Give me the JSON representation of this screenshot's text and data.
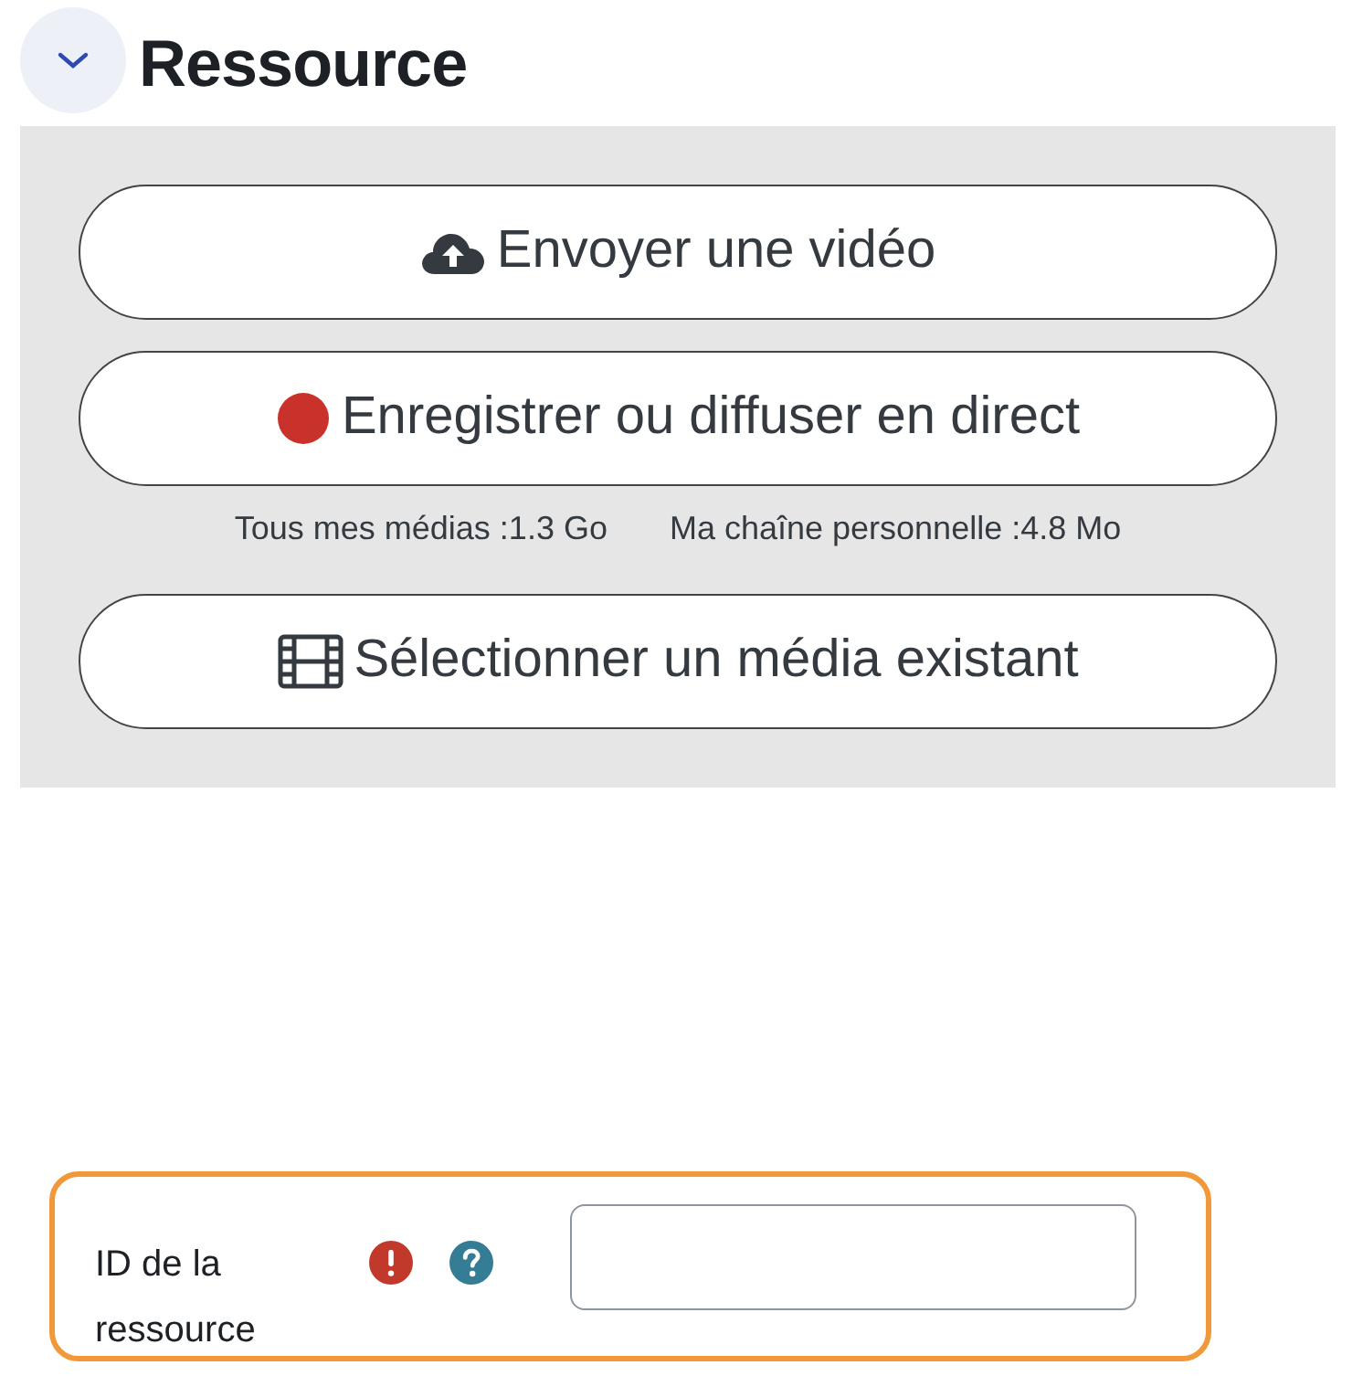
{
  "section": {
    "title": "Ressource",
    "expanded": true
  },
  "buttons": [
    {
      "kind": "upload",
      "label": "Envoyer une vidéo"
    },
    {
      "kind": "record",
      "label": "Enregistrer ou diffuser en direct"
    },
    {
      "kind": "film",
      "label": "Sélectionner un média existant"
    }
  ],
  "quotas": [
    "Tous mes médias :1.3 Go",
    "Ma chaîne personnelle :4.8 Mo"
  ],
  "field": {
    "label": "ID de la ressource",
    "required": true,
    "help": true,
    "highlighted": true
  }
}
